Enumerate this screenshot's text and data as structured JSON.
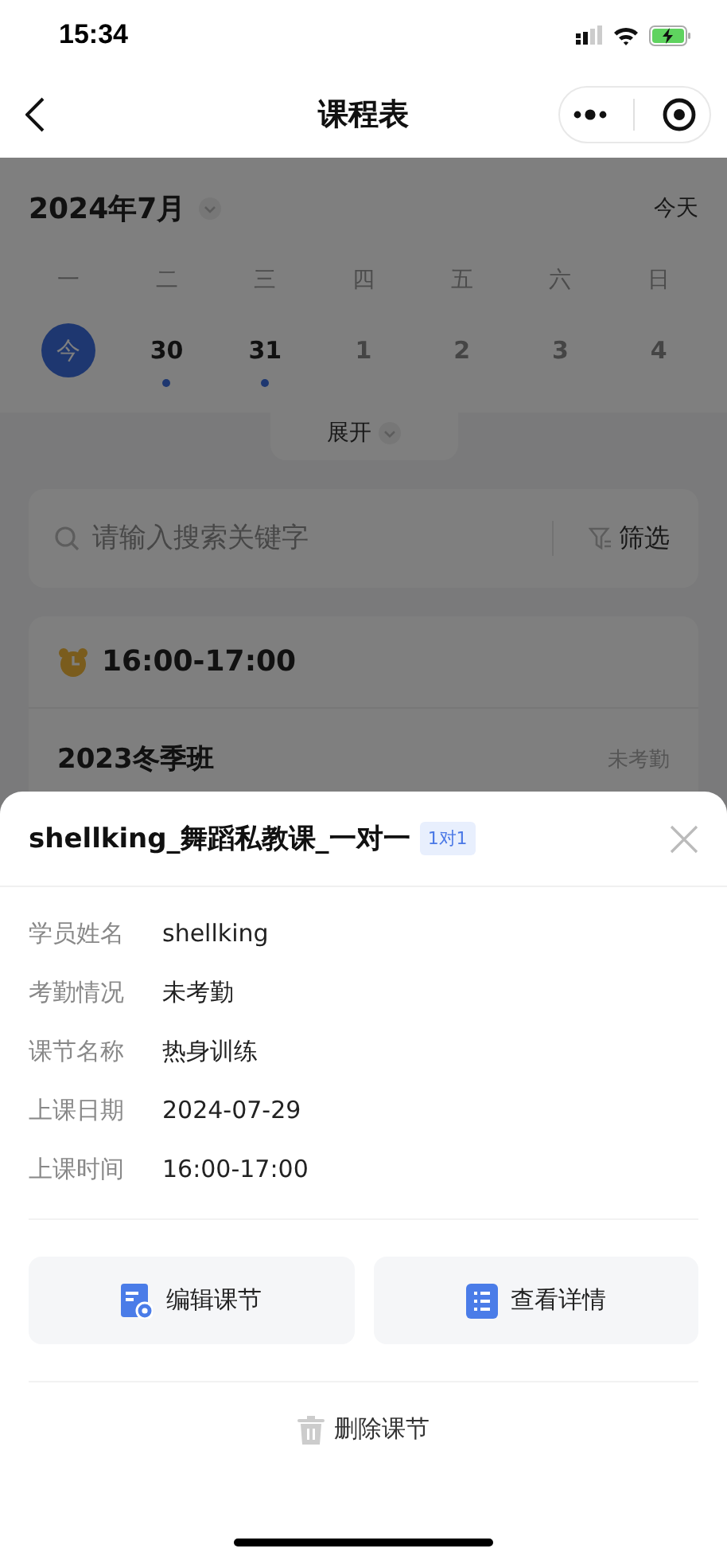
{
  "status_bar": {
    "time": "15:34"
  },
  "nav": {
    "title": "课程表"
  },
  "calendar": {
    "month": "2024年7月",
    "today_button": "今天",
    "weekdays": [
      "一",
      "二",
      "三",
      "四",
      "五",
      "六",
      "日"
    ],
    "days": [
      {
        "label": "今",
        "selected": true,
        "other_month": false,
        "has_lesson": false
      },
      {
        "label": "30",
        "selected": false,
        "other_month": false,
        "has_lesson": true
      },
      {
        "label": "31",
        "selected": false,
        "other_month": false,
        "has_lesson": true
      },
      {
        "label": "1",
        "selected": false,
        "other_month": true,
        "has_lesson": false
      },
      {
        "label": "2",
        "selected": false,
        "other_month": true,
        "has_lesson": false
      },
      {
        "label": "3",
        "selected": false,
        "other_month": true,
        "has_lesson": false
      },
      {
        "label": "4",
        "selected": false,
        "other_month": true,
        "has_lesson": false
      }
    ],
    "expand": "展开"
  },
  "search": {
    "placeholder": "请输入搜索关键字",
    "filter": "筛选"
  },
  "lesson_card": {
    "time": "16:00-17:00",
    "class_name": "2023冬季班",
    "status": "未考勤"
  },
  "sheet": {
    "title": "shellking_舞蹈私教课_一对一",
    "tag": "1对1",
    "fields": [
      {
        "label": "学员姓名",
        "value": "shellking"
      },
      {
        "label": "考勤情况",
        "value": "未考勤"
      },
      {
        "label": "课节名称",
        "value": "热身训练"
      },
      {
        "label": "上课日期",
        "value": "2024-07-29"
      },
      {
        "label": "上课时间",
        "value": "16:00-17:00"
      }
    ],
    "actions": [
      {
        "kind": "edit",
        "label": "编辑课节"
      },
      {
        "kind": "details",
        "label": "查看详情"
      }
    ],
    "delete": "删除课节"
  }
}
